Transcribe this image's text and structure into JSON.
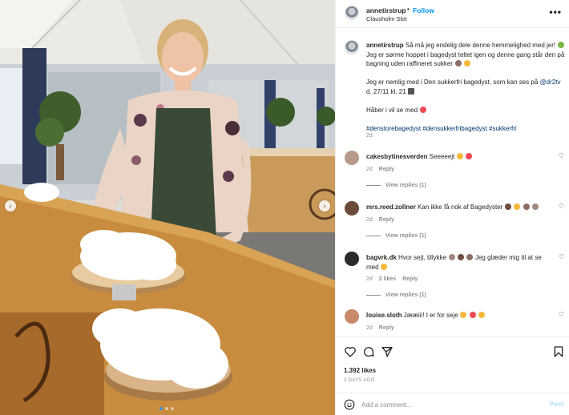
{
  "post": {
    "username": "annetirstrup",
    "follow_label": "Follow",
    "location": "Clausholm Slot",
    "more_label": "•••"
  },
  "caption": {
    "username": "annetirstrup",
    "line1": "Så må jeg endelig dele denne hemmelighed med jer!",
    "line2": "Jeg er sørme hoppet i bagedyst teltet igen og denne gang står den på bagning uden raffineret sukker",
    "line3a": "Jeg er nemlig med i Den sukkerfri bagedyst, som kan ses på",
    "mention": "@dr2tv",
    "line3b": "d. 27/11 kl. 21",
    "line4": "Håber i vil se med",
    "hashtags": "#denstorebagedyst #densukkerfribagedyst #sukkerfri",
    "time": "2d"
  },
  "comments": [
    {
      "username": "cakesbytinesverden",
      "text": "Seeeeejt",
      "time": "2d",
      "reply_label": "Reply",
      "view_replies": "View replies (1)",
      "likes": "",
      "avatar_color": "#b89a8a"
    },
    {
      "username": "mrs.reed.zollner",
      "text": "Kan ikke få nok af Bagedyster",
      "time": "2d",
      "reply_label": "Reply",
      "view_replies": "View replies (1)",
      "likes": "",
      "avatar_color": "#6b4b3a"
    },
    {
      "username": "bagvrk.dk",
      "text": "Hvor sejt, tillykke",
      "text2": "Jeg glæder mig til at se med",
      "time": "2d",
      "likes": "2 likes",
      "reply_label": "Reply",
      "view_replies": "View replies (1)",
      "avatar_color": "#2b2b2b"
    },
    {
      "username": "louise.sloth",
      "text": "Jææiii! I er for seje",
      "time": "2d",
      "reply_label": "Reply",
      "likes": "",
      "avatar_color": "#c88a6a"
    }
  ],
  "actions": {
    "likes": "1.392 likes",
    "date": "2 DAYS AGO"
  },
  "add_comment": {
    "placeholder": "Add a comment...",
    "post_label": "Post"
  },
  "nav": {
    "prev": "‹",
    "next": "›"
  },
  "colors": {
    "accent": "#0095f6",
    "link": "#00376b",
    "muted": "#8e8e8e",
    "heart": "#ed4956"
  }
}
